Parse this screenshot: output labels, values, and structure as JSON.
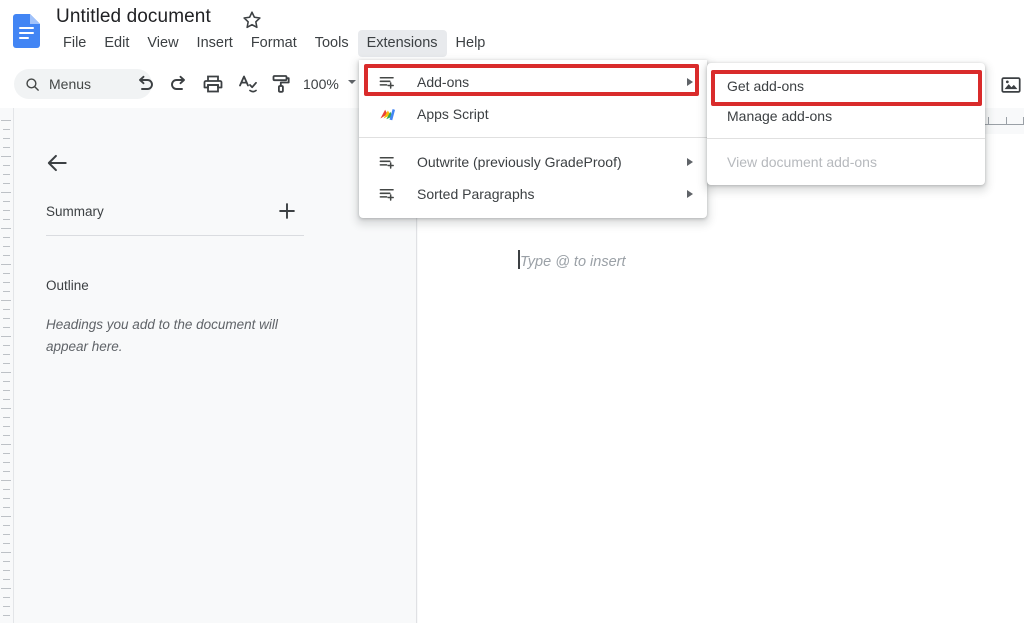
{
  "app": {
    "doc_title": "Untitled document",
    "docs_icon": "google-docs-icon",
    "star_icon": "star-outline-icon"
  },
  "menubar": {
    "items": [
      {
        "label": "File",
        "active": false
      },
      {
        "label": "Edit",
        "active": false
      },
      {
        "label": "View",
        "active": false
      },
      {
        "label": "Insert",
        "active": false
      },
      {
        "label": "Format",
        "active": false
      },
      {
        "label": "Tools",
        "active": false
      },
      {
        "label": "Extensions",
        "active": true
      },
      {
        "label": "Help",
        "active": false
      }
    ]
  },
  "toolbar": {
    "menus_label": "Menus",
    "search_icon": "search-icon",
    "undo_icon": "undo-icon",
    "redo_icon": "redo-icon",
    "print_icon": "print-icon",
    "spellcheck_icon": "spellcheck-icon",
    "paint_format_icon": "paint-format-icon",
    "zoom_value": "100%",
    "zoom_caret_icon": "chevron-down-icon",
    "image_icon": "insert-image-icon"
  },
  "sidepanel": {
    "back_icon": "arrow-back-icon",
    "summary_label": "Summary",
    "add_icon": "plus-icon",
    "outline_label": "Outline",
    "outline_empty": "Headings you add to the document will appear here."
  },
  "document": {
    "placeholder": "Type @ to insert"
  },
  "extensions_menu": {
    "items": [
      {
        "label": "Add-ons",
        "icon": "addons-icon",
        "has_submenu": true,
        "highlighted": true
      },
      {
        "label": "Apps Script",
        "icon": "apps-script-icon",
        "has_submenu": false,
        "highlighted": false
      },
      {
        "label": "Outwrite (previously GradeProof)",
        "icon": "addons-icon",
        "has_submenu": true,
        "highlighted": false
      },
      {
        "label": "Sorted Paragraphs",
        "icon": "addons-icon",
        "has_submenu": true,
        "highlighted": false
      }
    ]
  },
  "addons_submenu": {
    "items": [
      {
        "label": "Get add-ons",
        "disabled": false,
        "highlighted": true
      },
      {
        "label": "Manage add-ons",
        "disabled": false,
        "highlighted": false
      },
      {
        "label": "View document add-ons",
        "disabled": true,
        "highlighted": false
      }
    ]
  },
  "annotations": {
    "highlight_color": "#d92b2b",
    "boxes": [
      {
        "target": "Add-ons"
      },
      {
        "target": "Get add-ons"
      }
    ]
  }
}
